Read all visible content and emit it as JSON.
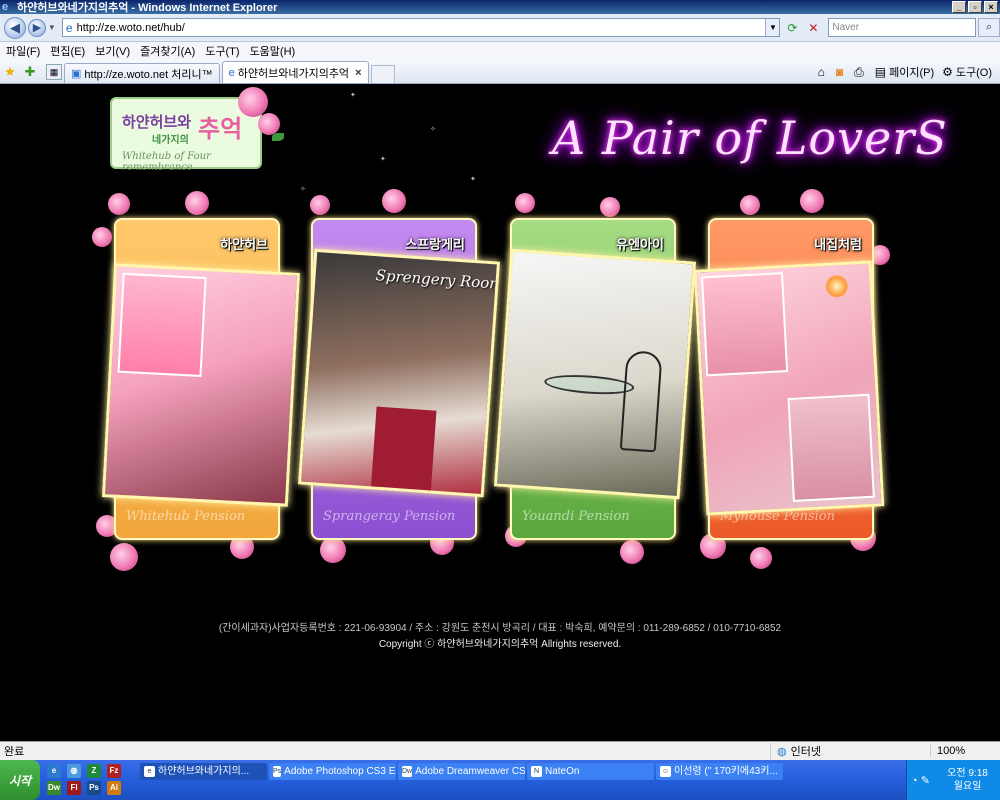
{
  "window": {
    "title": "하얀허브와네가지의추억 - Windows Internet Explorer",
    "minimize": "_",
    "maximize": "▫",
    "close": "×"
  },
  "address": {
    "url": "http://ze.woto.net/hub/",
    "search_placeholder": "Naver"
  },
  "menu": [
    "파일(F)",
    "편집(E)",
    "보기(V)",
    "즐겨찾기(A)",
    "도구(T)",
    "도움말(H)"
  ],
  "tabs": [
    {
      "label": "http://ze.woto.net 처리니™"
    },
    {
      "label": "하얀허브와네가지의추억"
    }
  ],
  "command_bar": {
    "page": "페이지(P)",
    "tools": "도구(O)"
  },
  "page": {
    "logo": {
      "korean_main": "하얀허브와",
      "korean_accent": "추억",
      "korean_sub": "네가지의",
      "english": "Whitehub of Four remembrance"
    },
    "headline": "A Pair of LoverS",
    "cards": [
      {
        "title": "하얀허브",
        "name": "Whitehub Pension"
      },
      {
        "title": "스프랑게리",
        "name": "Sprangeray Pension"
      },
      {
        "title": "유엔아이",
        "name": "Youandi Pension"
      },
      {
        "title": "내집처럼",
        "name": "Myhouse Pension"
      }
    ],
    "photo_label": "Sprengery Room",
    "footer": {
      "line1": "(간이세과자)사업자등록번호 : 221-06-93904 / 주소 : 강원도 춘천시 방곡리 / 대표 : 박숙희, 예약문의 : 011-289-6852 / 010-7710-6852",
      "line2": "Copyright ⓒ 하얀허브와네가지의추억 Allrights reserved."
    }
  },
  "status": {
    "text": "완료",
    "zone": "인터넷",
    "zoom": "100%"
  },
  "taskbar": {
    "start": "시작",
    "tasks": [
      {
        "label": "하얀허브와네가지의..."
      },
      {
        "label": "Adobe Photoshop CS3 E..."
      },
      {
        "label": "Adobe Dreamweaver CS3"
      },
      {
        "label": "NateOn"
      },
      {
        "label": "이선령 (\" 170키에43키..."
      }
    ],
    "clock_time": "오전 9:18",
    "clock_day": "월요일"
  }
}
